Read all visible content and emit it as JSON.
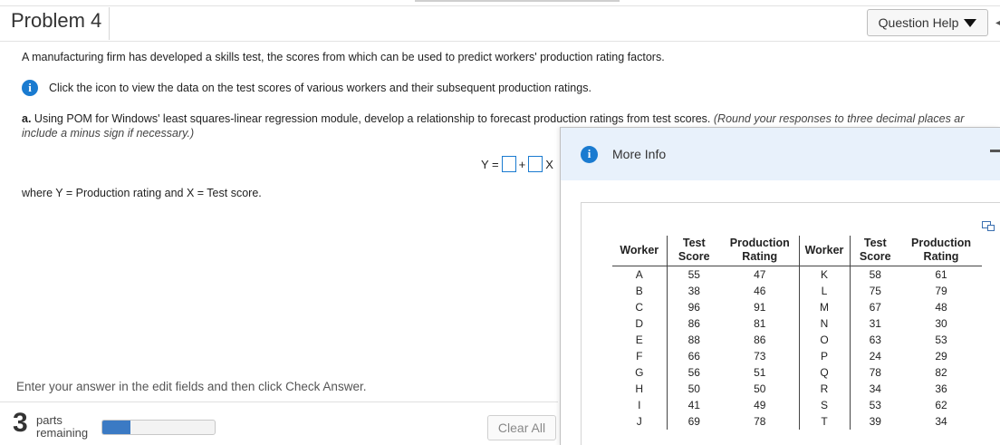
{
  "header": {
    "title": "Problem 4",
    "help_button": "Question Help"
  },
  "question": {
    "intro": "A manufacturing firm has developed a skills test, the scores from which can be used to predict workers' production rating factors.",
    "info_link": "Click the icon to view the data on the test scores of various workers and their subsequent production ratings.",
    "part_a_label": "a.",
    "part_a_text": "Using POM for Windows' least squares-linear regression module, develop a relationship to forecast production ratings from test scores.",
    "part_a_hint": "(Round your responses to three decimal places ar",
    "part_a_hint2": "include a minus sign if necessary.)",
    "equation": {
      "lhs": "Y =",
      "plus": "+",
      "x": "X"
    },
    "where_text": "where Y = Production rating and X = Test score."
  },
  "footer": {
    "instruction": "Enter your answer in the edit fields and then click Check Answer.",
    "parts_count": "3",
    "parts_word": "parts",
    "remaining_word": "remaining",
    "progress_fraction": 0.25,
    "clear_all": "Clear All"
  },
  "modal": {
    "title": "More Info",
    "headers": {
      "worker": "Worker",
      "test1": "Test",
      "test2": "Score",
      "prod1": "Production",
      "prod2": "Rating"
    },
    "rows": [
      [
        "A",
        "55",
        "47",
        "K",
        "58",
        "61"
      ],
      [
        "B",
        "38",
        "46",
        "L",
        "75",
        "79"
      ],
      [
        "C",
        "96",
        "91",
        "M",
        "67",
        "48"
      ],
      [
        "D",
        "86",
        "81",
        "N",
        "31",
        "30"
      ],
      [
        "E",
        "88",
        "86",
        "O",
        "63",
        "53"
      ],
      [
        "F",
        "66",
        "73",
        "P",
        "24",
        "29"
      ],
      [
        "G",
        "56",
        "51",
        "Q",
        "78",
        "82"
      ],
      [
        "H",
        "50",
        "50",
        "R",
        "34",
        "36"
      ],
      [
        "I",
        "41",
        "49",
        "S",
        "53",
        "62"
      ],
      [
        "J",
        "69",
        "78",
        "T",
        "39",
        "34"
      ]
    ]
  },
  "colors": {
    "accent": "#1a7bd0",
    "progress": "#3b7ac4",
    "modal_header": "#e8f1fb"
  },
  "icons": {
    "info": "info-icon",
    "help_caret": "caret-down-icon",
    "copy": "copy-icon",
    "minimize": "minimize-icon"
  }
}
